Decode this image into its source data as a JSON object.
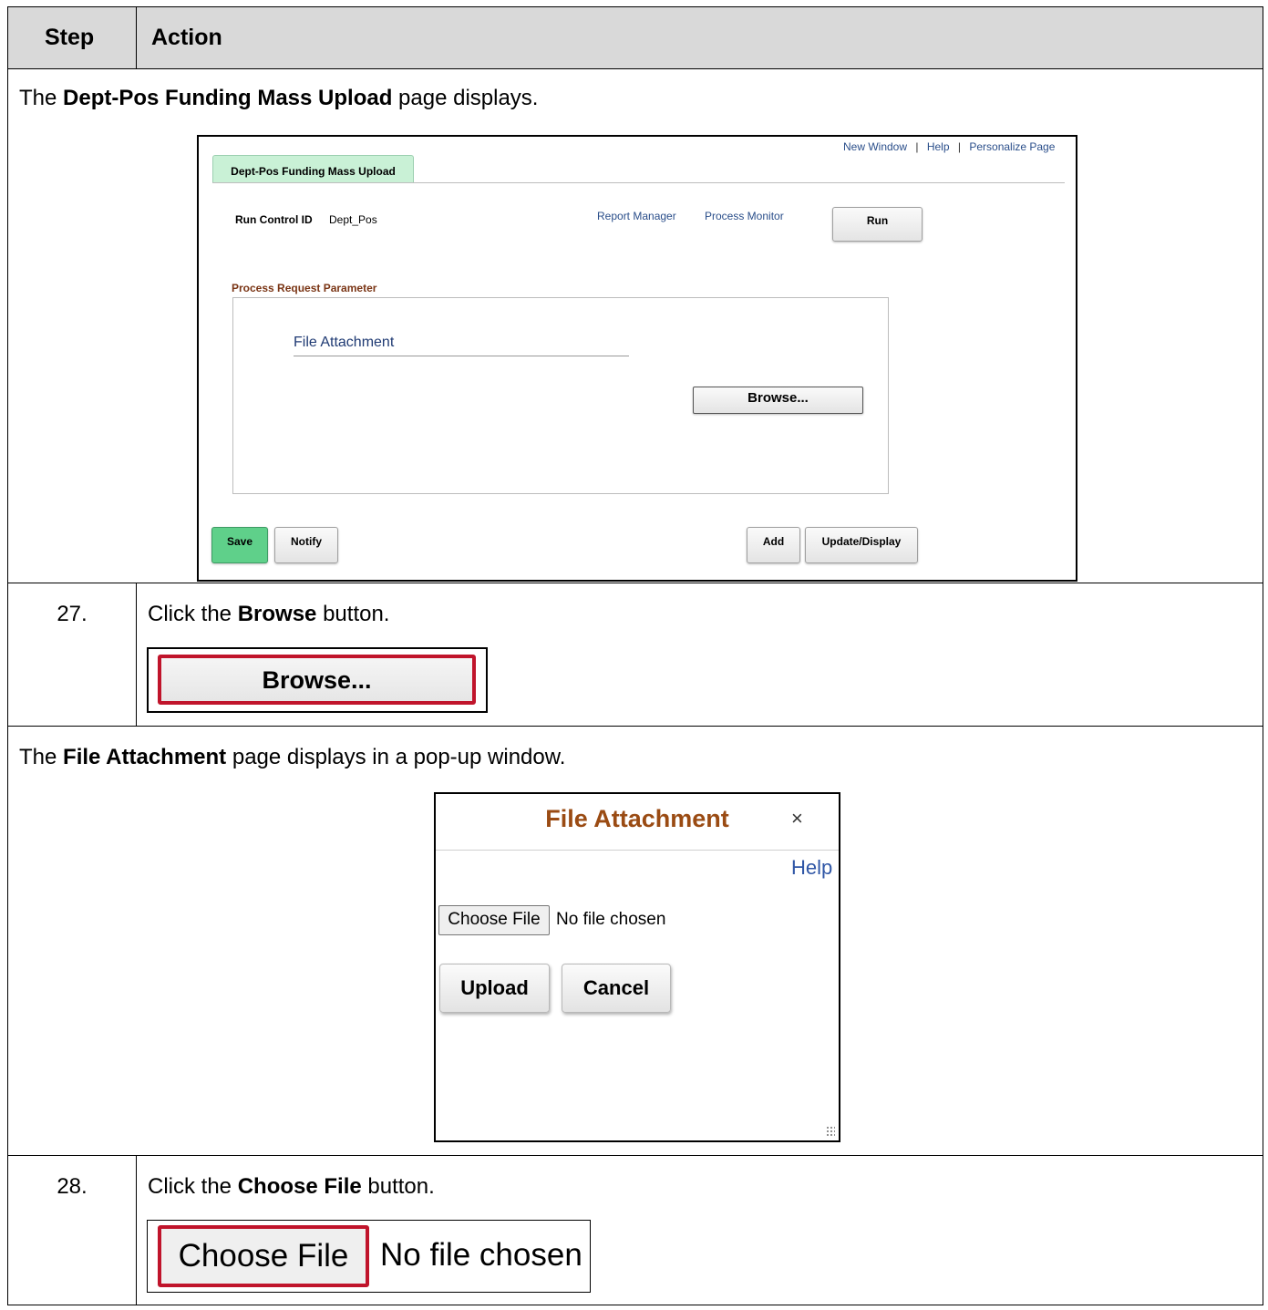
{
  "table": {
    "header": {
      "step": "Step",
      "action": "Action"
    },
    "row1": {
      "prefix": "The ",
      "bold": "Dept-Pos Funding Mass Upload",
      "suffix": " page displays."
    },
    "row2": {
      "step": "27.",
      "prefix": "Click the ",
      "bold": "Browse",
      "suffix": " button."
    },
    "row3": {
      "prefix": "The ",
      "bold": "File Attachment",
      "suffix": " page displays in a pop-up window."
    },
    "row4": {
      "step": "28.",
      "prefix": "Click the ",
      "bold": "Choose File",
      "suffix": " button."
    }
  },
  "screen1": {
    "top_links": {
      "new_window": "New Window",
      "help": "Help",
      "personalize": "Personalize Page",
      "sep": "|"
    },
    "tab": "Dept-Pos Funding Mass Upload",
    "run_control_label": "Run Control ID",
    "run_control_value": "Dept_Pos",
    "report_manager": "Report Manager",
    "process_monitor": "Process Monitor",
    "run_button": "Run",
    "section_title": "Process Request Parameter",
    "file_attachment_label": "File Attachment",
    "browse_button": "Browse...",
    "save_button": "Save",
    "notify_button": "Notify",
    "add_button": "Add",
    "update_display_button": "Update/Display"
  },
  "browse_callout": {
    "label": "Browse..."
  },
  "popup": {
    "title": "File Attachment",
    "close": "×",
    "help": "Help",
    "choose_file": "Choose File",
    "no_file": "No file chosen",
    "upload": "Upload",
    "cancel": "Cancel"
  },
  "choose_callout": {
    "choose_file": "Choose File",
    "no_file": "No file chosen"
  },
  "colors": {
    "highlight": "#c0142b",
    "save_green": "#5fd08a",
    "tab_green": "#c9f1d6",
    "section_brown": "#7a3515",
    "popup_title": "#9a4b13",
    "link_blue": "#2a4e8a"
  }
}
